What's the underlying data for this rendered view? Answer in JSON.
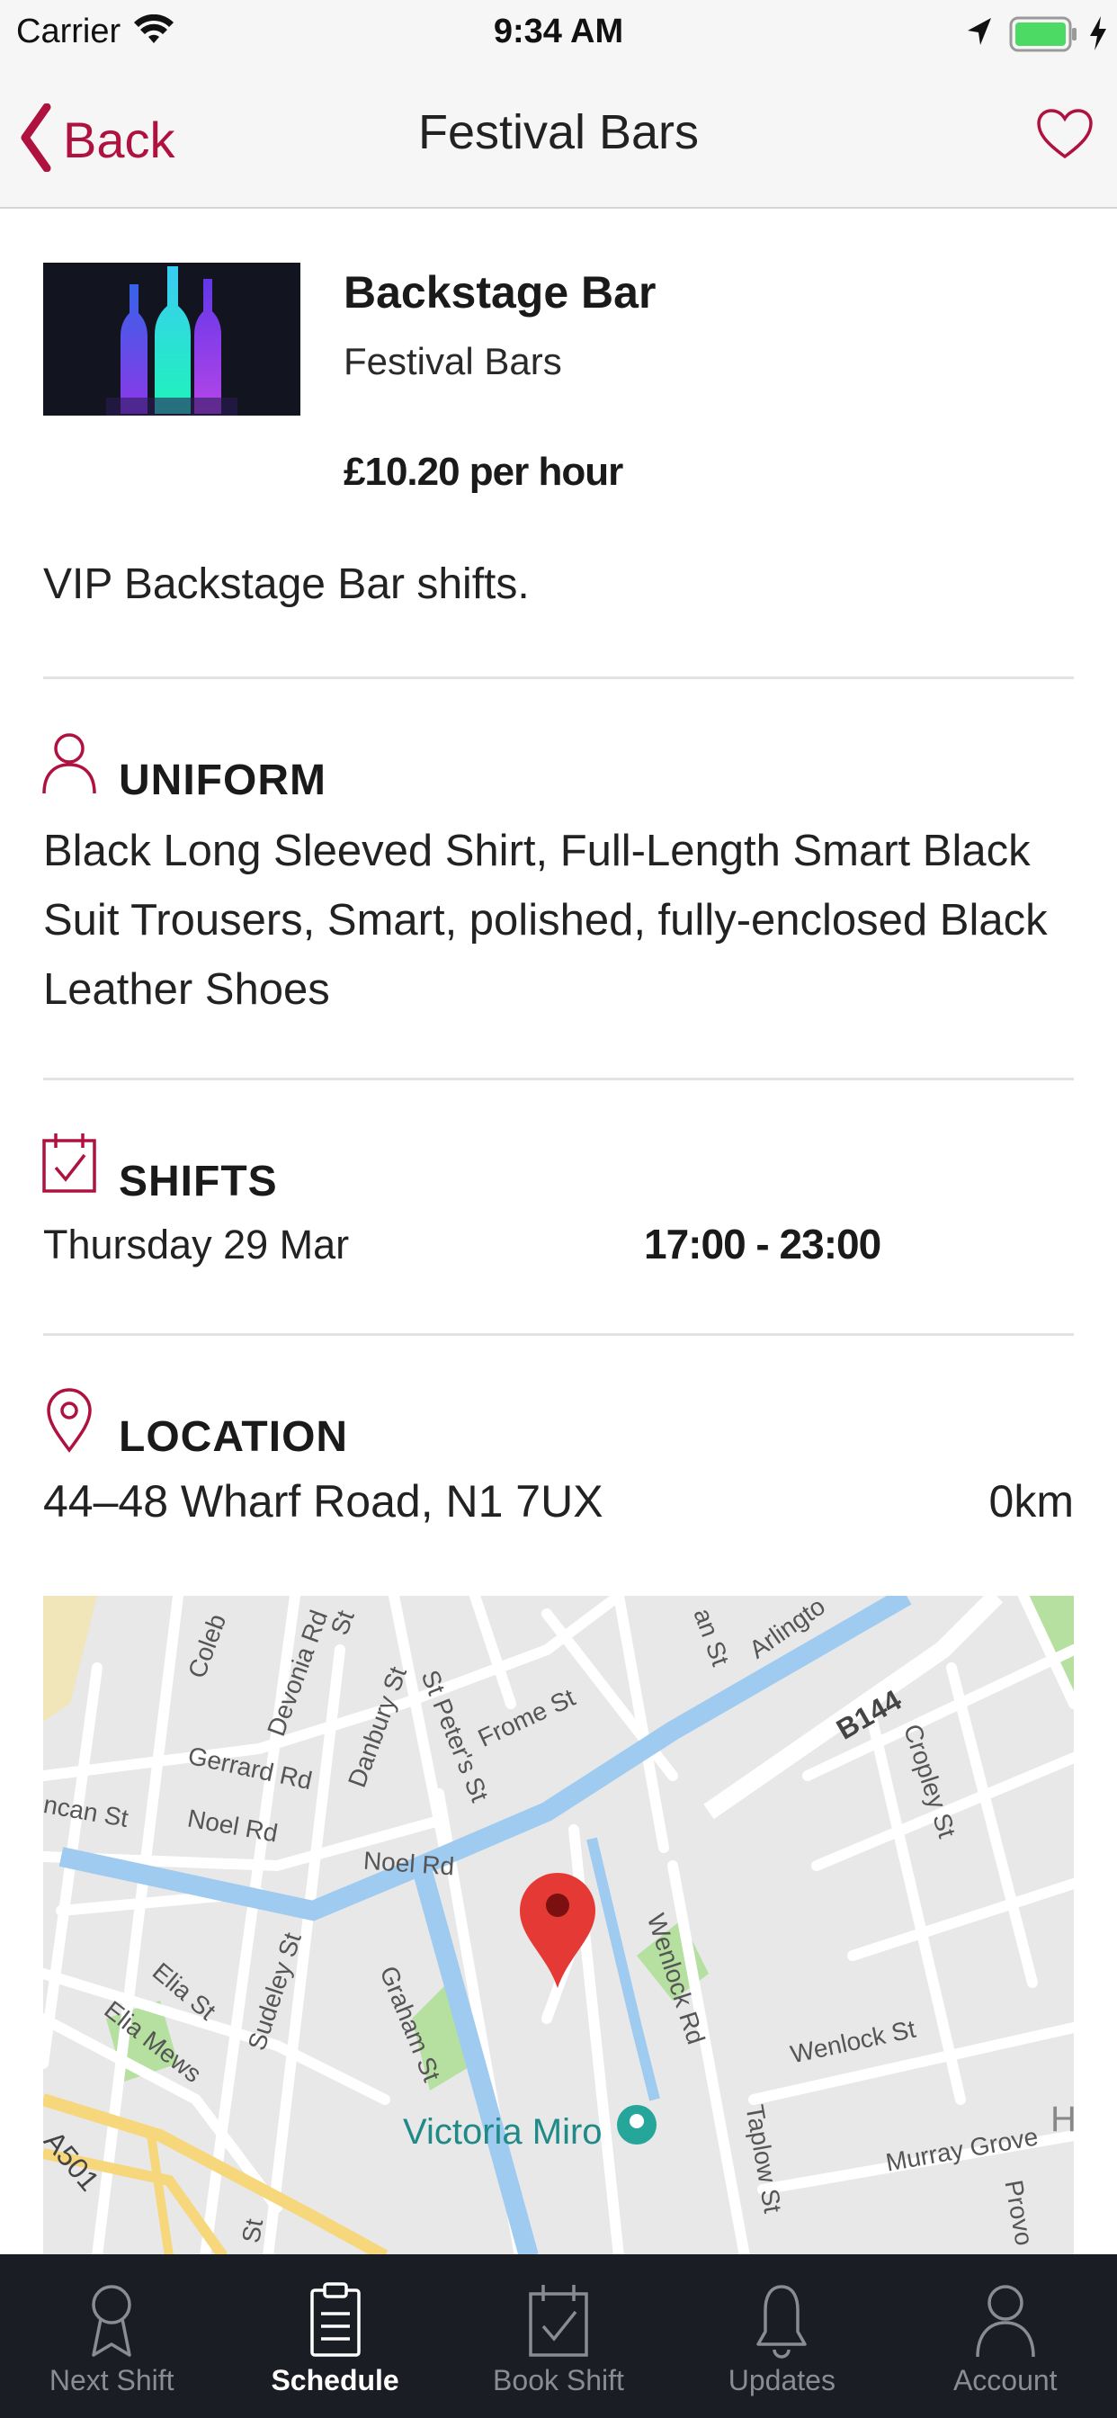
{
  "status_bar": {
    "carrier": "Carrier",
    "time": "9:34 AM"
  },
  "nav": {
    "back_label": "Back",
    "title": "Festival Bars",
    "favorite_icon": "heart-outline-icon"
  },
  "venue": {
    "name": "Backstage Bar",
    "category": "Festival Bars",
    "rate": "£10.20 per hour",
    "description": "VIP Backstage Bar shifts."
  },
  "uniform": {
    "title": "UNIFORM",
    "icon": "person-icon",
    "text": "Black Long Sleeved Shirt, Full-Length Smart Black Suit Trousers, Smart, polished, fully-enclosed Black Leather Shoes"
  },
  "shifts": {
    "title": "SHIFTS",
    "icon": "calendar-check-icon",
    "items": [
      {
        "date": "Thursday 29 Mar",
        "time": "17:00 - 23:00"
      }
    ]
  },
  "location": {
    "title": "LOCATION",
    "icon": "location-pin-icon",
    "address": "44–48 Wharf Road, N1 7UX",
    "distance": "0km"
  },
  "map": {
    "labels": {
      "coleb": "Coleb",
      "devonia_rd": "Devonia Rd",
      "st_top": "St",
      "danbury_st": "Danbury St",
      "st_peters_st": "St Peter's St",
      "frome_st": "Frome St",
      "gerrard_rd": "Gerrard Rd",
      "ncan_st": "ncan St",
      "noel_rd_1": "Noel Rd",
      "noel_rd_2": "Noel Rd",
      "elia_st": "Elia St",
      "sudeley_st": "Sudeley St",
      "elia_mews": "Elia Mews",
      "graham_st": "Graham St",
      "wenlock_rd": "Wenlock Rd",
      "wenlock_st": "Wenlock St",
      "taplow_st": "Taplow St",
      "murray_grove": "Murray Grove",
      "cropley_st": "Cropley St",
      "b144": "B144",
      "arlington": "Arlingto",
      "an_st": "an St",
      "a501": "A501",
      "st_bottom": "St",
      "provost": "Provo",
      "h": "H"
    },
    "poi_label": "Victoria Miro",
    "colors": {
      "land": "#e8e8e8",
      "road": "#ffffff",
      "water": "#9ecbef",
      "park": "#b5e0a0",
      "major_road": "#f6d77b",
      "pin": "#e53935"
    }
  },
  "tabs": [
    {
      "label": "Next Shift",
      "icon": "ribbon-icon",
      "active": false
    },
    {
      "label": "Schedule",
      "icon": "clipboard-icon",
      "active": true
    },
    {
      "label": "Book Shift",
      "icon": "calendar-check-icon",
      "active": false
    },
    {
      "label": "Updates",
      "icon": "bell-icon",
      "active": false
    },
    {
      "label": "Account",
      "icon": "person-icon",
      "active": false
    }
  ],
  "colors": {
    "accent": "#b0123f",
    "tab_bar": "#1b1d24"
  }
}
